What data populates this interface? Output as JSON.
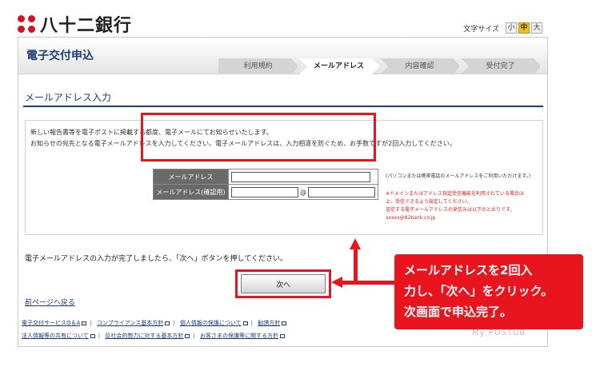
{
  "header": {
    "bank_name": "八十二銀行",
    "font_size_label": "文字サイズ",
    "font_sizes": [
      "小",
      "中",
      "大"
    ],
    "font_size_selected": "中",
    "brand_color": "#d2141e"
  },
  "page": {
    "title": "電子交付申込",
    "steps": [
      {
        "label": "利用規約",
        "active": false
      },
      {
        "label": "メールアドレス",
        "active": true
      },
      {
        "label": "内容確認",
        "active": false
      },
      {
        "label": "受付完了",
        "active": false
      }
    ]
  },
  "section": {
    "title": "メールアドレス入力",
    "intro_line1": "新しい報告書等を電子ポストに掲載する都度、電子メールにてお知らせいたします。",
    "intro_line2": "お知らせの宛先となる電子メールアドレスを入力してください。電子メールアドレスは、入力相違を防ぐため、お手数ですが2回入力してください。"
  },
  "form": {
    "email_label": "メールアドレス",
    "email_confirm_label": "メールアドレス(確認用)",
    "email_value": "",
    "email_confirm_local": "",
    "email_confirm_domain": "",
    "at_sign": "@",
    "note1": "(パソコンまたは携帯電話のメールアドレスをご利用いただけます。)",
    "note_red": [
      "※ドメインまたはアドレス指定受信機能を利用されている場合は",
      "上、受信できるよう設定してください。",
      "送信する電子メールアドレスの発信元は以下のとおりです。",
      "xxxxx@82bank.co.jp"
    ]
  },
  "instructions": {
    "completion_text": "電子メールアドレスの入力が完了しましたら、「次へ」ボタンを押してください。",
    "next_label": "次へ",
    "back_label": "前ページへ戻る"
  },
  "footer": {
    "links_row1": [
      "電子交付サービスQ＆A",
      "コンプライアンス基本方針",
      "個人情報の保護について",
      "勧誘方針"
    ],
    "links_row2": [
      "法人情報等の共有について",
      "反社会的勢力に対する基本方針",
      "お客さまの保護等に関する方針"
    ]
  },
  "callout": {
    "line1": "メールアドレスを2回入",
    "line2": "力し、「次へ」をクリック。",
    "line3": "次画面で申込完了。",
    "color": "#e8141e"
  },
  "watermark": "My POSTUB"
}
